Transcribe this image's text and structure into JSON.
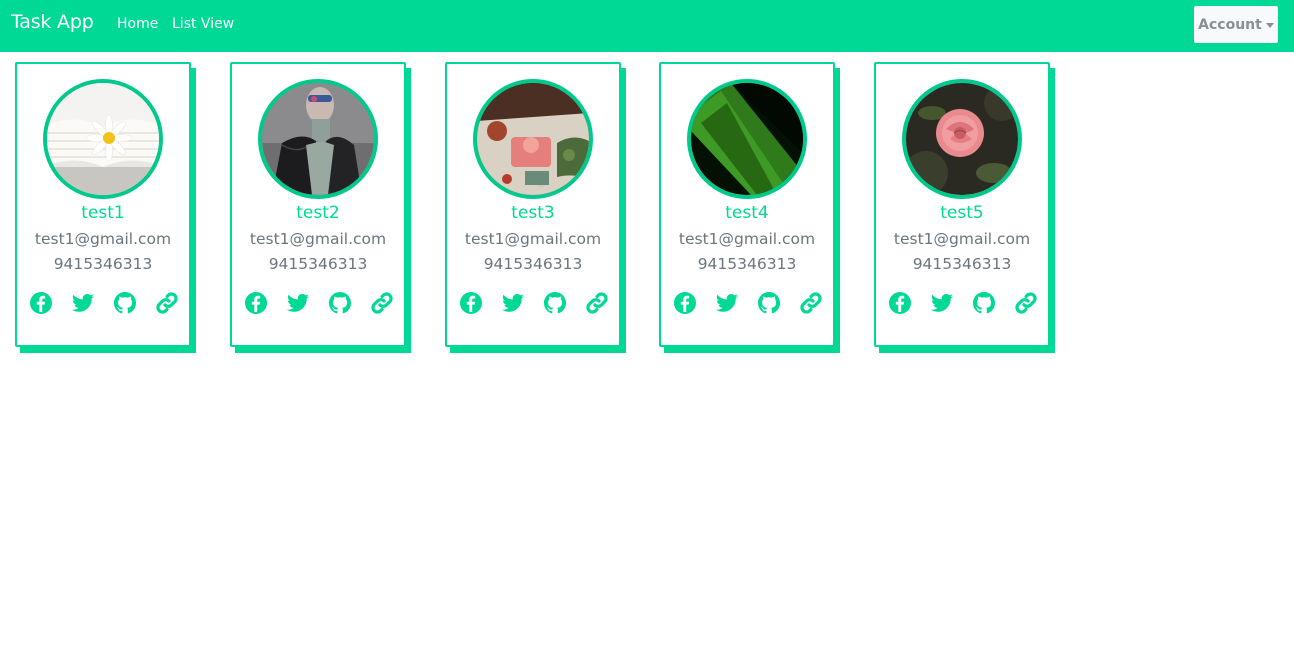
{
  "navbar": {
    "brand": "Task App",
    "links": [
      {
        "label": "Home"
      },
      {
        "label": "List View"
      }
    ],
    "account_label": "Account"
  },
  "colors": {
    "accent": "#00d995",
    "text_muted": "#6c757d",
    "account_bg": "#f8f9fa"
  },
  "cards": [
    {
      "name": "test1",
      "email": "test1@gmail.com",
      "phone": "9415346313",
      "avatar": "daisy-on-book-photo"
    },
    {
      "name": "test2",
      "email": "test1@gmail.com",
      "phone": "9415346313",
      "avatar": "person-in-leather-jacket-photo"
    },
    {
      "name": "test3",
      "email": "test1@gmail.com",
      "phone": "9415346313",
      "avatar": "food-table-photo"
    },
    {
      "name": "test4",
      "email": "test1@gmail.com",
      "phone": "9415346313",
      "avatar": "green-leaf-photo"
    },
    {
      "name": "test5",
      "email": "test1@gmail.com",
      "phone": "9415346313",
      "avatar": "pink-rose-photo"
    }
  ],
  "social_icons": [
    "facebook-icon",
    "twitter-icon",
    "github-icon",
    "link-icon"
  ]
}
